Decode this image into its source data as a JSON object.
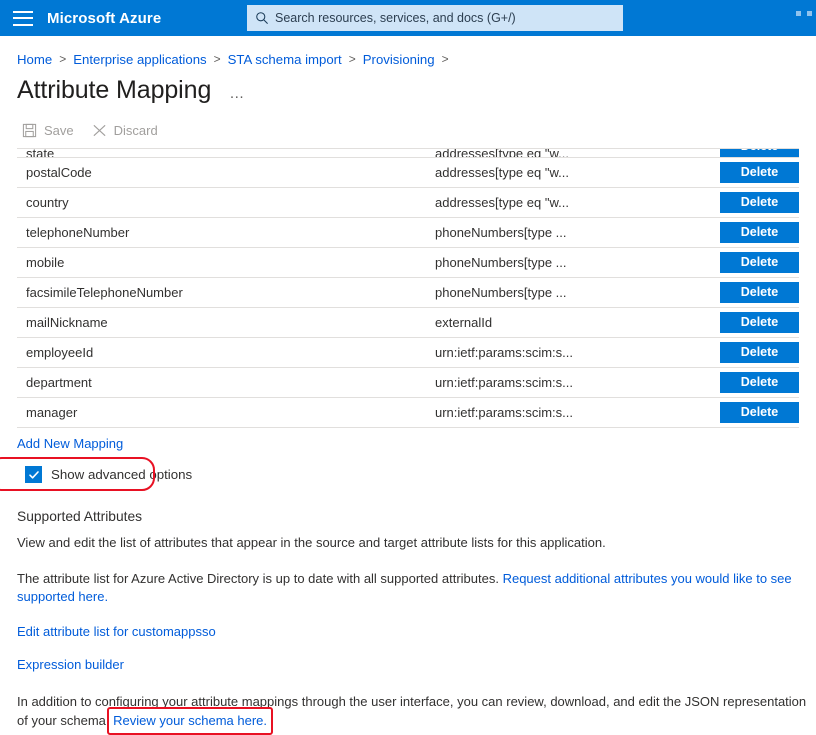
{
  "topbar": {
    "menu_icon": "hamburger-icon",
    "brand": "Microsoft Azure",
    "search": {
      "icon": "search-icon",
      "placeholder": "Search resources, services, and docs (G+/)"
    }
  },
  "breadcrumb": {
    "items": [
      "Home",
      "Enterprise applications",
      "STA schema import",
      "Provisioning"
    ],
    "separator": ">",
    "trailing_separator": ">"
  },
  "header": {
    "title": "Attribute Mapping",
    "ellipsis": "…"
  },
  "toolbar": {
    "save_label": "Save",
    "save_icon": "save-disk-icon",
    "discard_label": "Discard",
    "discard_icon": "close-x-icon",
    "disabled": true
  },
  "table": {
    "delete_label": "Delete",
    "rows": [
      {
        "source": "state",
        "target": "addresses[type eq \"w...",
        "clipped": true
      },
      {
        "source": "postalCode",
        "target": "addresses[type eq \"w...",
        "clipped": false
      },
      {
        "source": "country",
        "target": "addresses[type eq \"w...",
        "clipped": false
      },
      {
        "source": "telephoneNumber",
        "target": "phoneNumbers[type ...",
        "clipped": false
      },
      {
        "source": "mobile",
        "target": "phoneNumbers[type ...",
        "clipped": false
      },
      {
        "source": "facsimileTelephoneNumber",
        "target": "phoneNumbers[type ...",
        "clipped": false
      },
      {
        "source": "mailNickname",
        "target": "externalId",
        "clipped": false
      },
      {
        "source": "employeeId",
        "target": "urn:ietf:params:scim:s...",
        "clipped": false
      },
      {
        "source": "department",
        "target": "urn:ietf:params:scim:s...",
        "clipped": false
      },
      {
        "source": "manager",
        "target": "urn:ietf:params:scim:s...",
        "clipped": false
      }
    ]
  },
  "add_new_mapping": "Add New Mapping",
  "advanced": {
    "label": "Show advanced options",
    "checked": true,
    "highlighted": true
  },
  "supported_attributes": {
    "title": "Supported Attributes",
    "description": "View and edit the list of attributes that appear in the source and target attribute lists for this application.",
    "status_text": "The attribute list for Azure Active Directory is up to date with all supported attributes. ",
    "status_link": "Request additional attributes you would like to see supported here.",
    "edit_list_link": "Edit attribute list for customappsso",
    "expression_builder_link": "Expression builder"
  },
  "footer": {
    "text_before": "In addition to configuring your attribute mappings through the user interface, you can review, download, and edit the JSON representation of your schema. ",
    "link": "Review your schema here.",
    "link_highlighted": true
  },
  "colors": {
    "azure_blue": "#0078d4",
    "link_blue": "#015cda",
    "search_bg": "#cfe4f7",
    "annotation_red": "#e81123",
    "border": "#e1dfdd",
    "text": "#323130",
    "disabled_text": "#a19f9d"
  }
}
